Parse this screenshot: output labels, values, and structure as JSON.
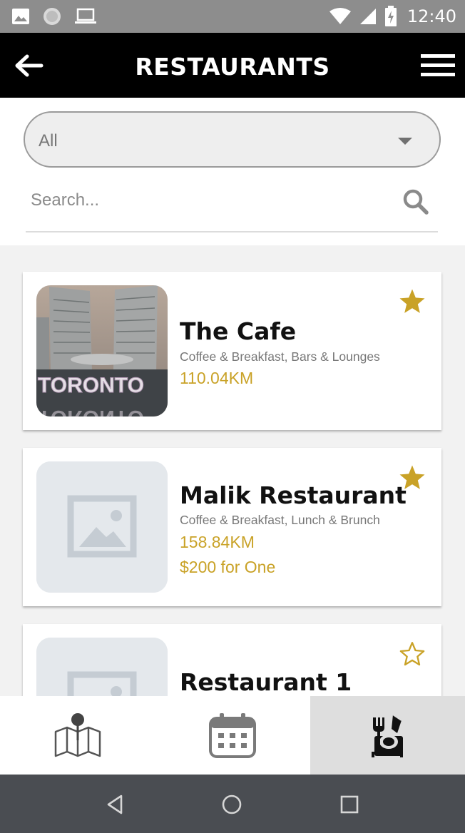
{
  "status_bar": {
    "time": "12:40",
    "icons": [
      "image-icon",
      "record-icon",
      "laptop-icon",
      "wifi-icon",
      "signal-icon",
      "battery-charging-icon"
    ]
  },
  "app_bar": {
    "title": "RESTAURANTS",
    "back_icon": "back-arrow-icon",
    "menu_icon": "hamburger-menu-icon"
  },
  "filter": {
    "selected": "All",
    "search_placeholder": "Search..."
  },
  "restaurants": [
    {
      "name": "The Cafe",
      "categories": "Coffee & Breakfast, Bars & Lounges",
      "distance": "110.04KM",
      "favorite": true,
      "image": "toronto-city-hall-photo"
    },
    {
      "name": "Malik Restaurant",
      "categories": "Coffee & Breakfast, Lunch & Brunch",
      "distance": "158.84KM",
      "price": "$200 for One",
      "favorite": true,
      "image": "placeholder-image"
    },
    {
      "name": "Restaurant 1",
      "favorite": false,
      "image": "placeholder-image"
    }
  ],
  "bottom_nav": [
    {
      "icon": "map-icon",
      "active": false
    },
    {
      "icon": "calendar-icon",
      "active": false
    },
    {
      "icon": "restaurant-icon",
      "active": true
    }
  ],
  "colors": {
    "accent": "#c9a227",
    "app_bar": "#000000",
    "status_bar": "#8d8d8d",
    "system_nav": "#4a4d52"
  }
}
